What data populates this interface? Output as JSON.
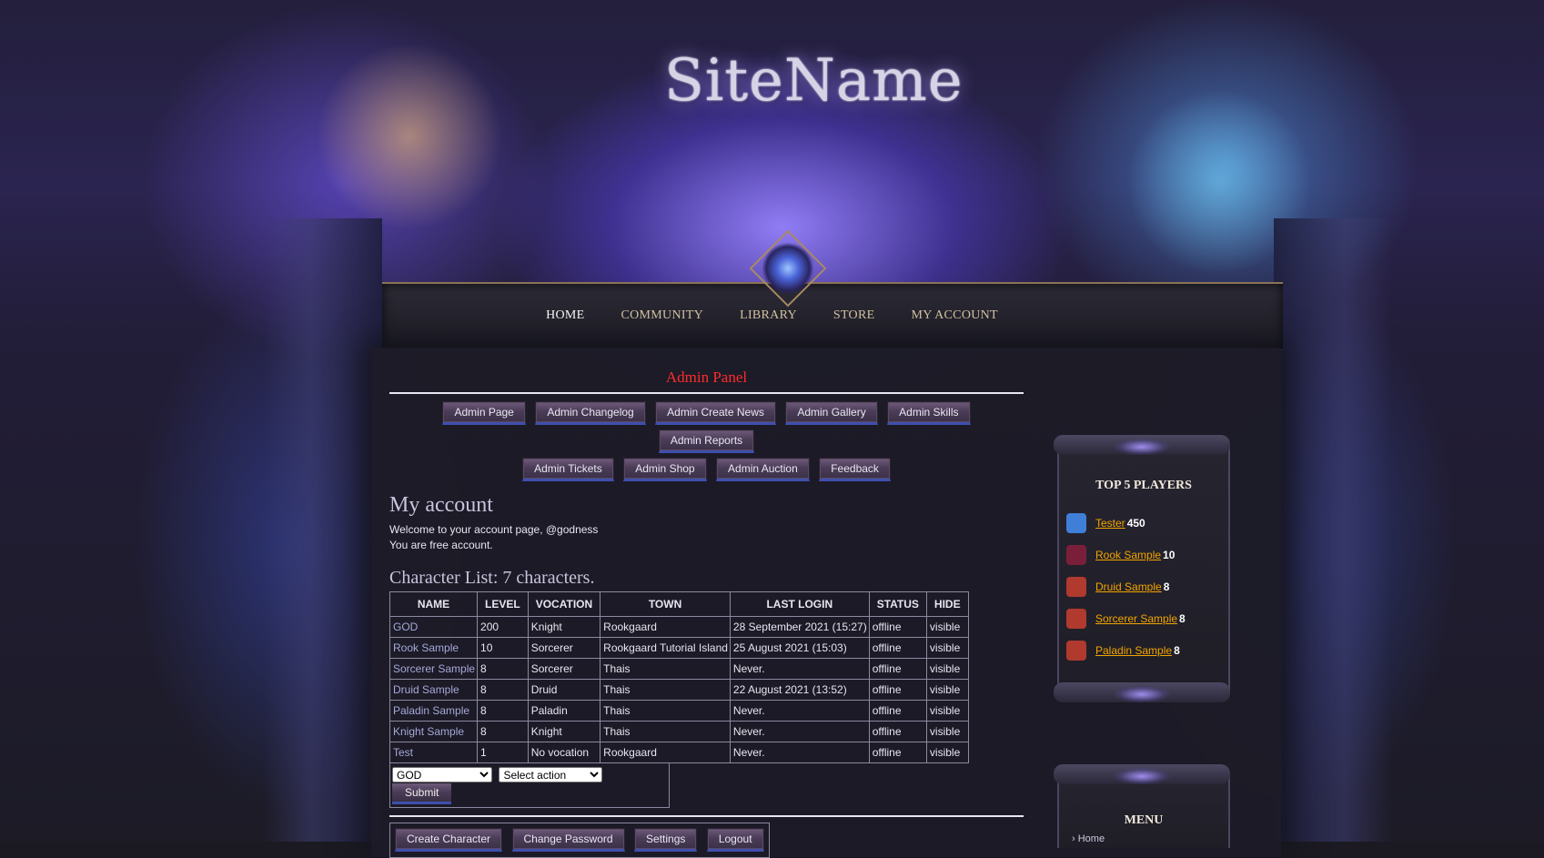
{
  "site": {
    "logo": "SiteName"
  },
  "nav": [
    "HOME",
    "COMMUNITY",
    "LIBRARY",
    "STORE",
    "MY ACCOUNT"
  ],
  "admin": {
    "title": "Admin Panel",
    "row1": [
      "Admin Page",
      "Admin Changelog",
      "Admin Create News",
      "Admin Gallery",
      "Admin Skills",
      "Admin Reports"
    ],
    "row2": [
      "Admin Tickets",
      "Admin Shop",
      "Admin Auction",
      "Feedback"
    ]
  },
  "account": {
    "heading": "My account",
    "welcome": "Welcome to your account page, @godness",
    "status": "You are free account."
  },
  "characters": {
    "heading": "Character List: 7 characters.",
    "columns": [
      "NAME",
      "LEVEL",
      "VOCATION",
      "TOWN",
      "LAST LOGIN",
      "STATUS",
      "HIDE"
    ],
    "rows": [
      [
        "GOD",
        "200",
        "Knight",
        "Rookgaard",
        "28 September 2021 (15:27)",
        "offline",
        "visible"
      ],
      [
        "Rook Sample",
        "10",
        "Sorcerer",
        "Rookgaard Tutorial Island",
        "25 August 2021 (15:03)",
        "offline",
        "visible"
      ],
      [
        "Sorcerer Sample",
        "8",
        "Sorcerer",
        "Thais",
        "Never.",
        "offline",
        "visible"
      ],
      [
        "Druid Sample",
        "8",
        "Druid",
        "Thais",
        "22 August 2021 (13:52)",
        "offline",
        "visible"
      ],
      [
        "Paladin Sample",
        "8",
        "Paladin",
        "Thais",
        "Never.",
        "offline",
        "visible"
      ],
      [
        "Knight Sample",
        "8",
        "Knight",
        "Thais",
        "Never.",
        "offline",
        "visible"
      ],
      [
        "Test",
        "1",
        "No vocation",
        "Rookgaard",
        "Never.",
        "offline",
        "visible"
      ]
    ],
    "select_character": "GOD",
    "select_action": "Select action",
    "submit": "Submit"
  },
  "account_buttons": [
    "Create Character",
    "Change Password",
    "Settings",
    "Logout"
  ],
  "top_players": {
    "title": "TOP 5 PLAYERS",
    "players": [
      {
        "name": "Tester",
        "level": "450",
        "color": "#3f7fd8"
      },
      {
        "name": "Rook Sample",
        "level": "10",
        "color": "#7a1f3a"
      },
      {
        "name": "Druid Sample",
        "level": "8",
        "color": "#b03a2e"
      },
      {
        "name": "Sorcerer Sample",
        "level": "8",
        "color": "#b03a2e"
      },
      {
        "name": "Paladin Sample",
        "level": "8",
        "color": "#b03a2e"
      }
    ]
  },
  "menu": {
    "title": "MENU",
    "first_item": "› Home"
  }
}
